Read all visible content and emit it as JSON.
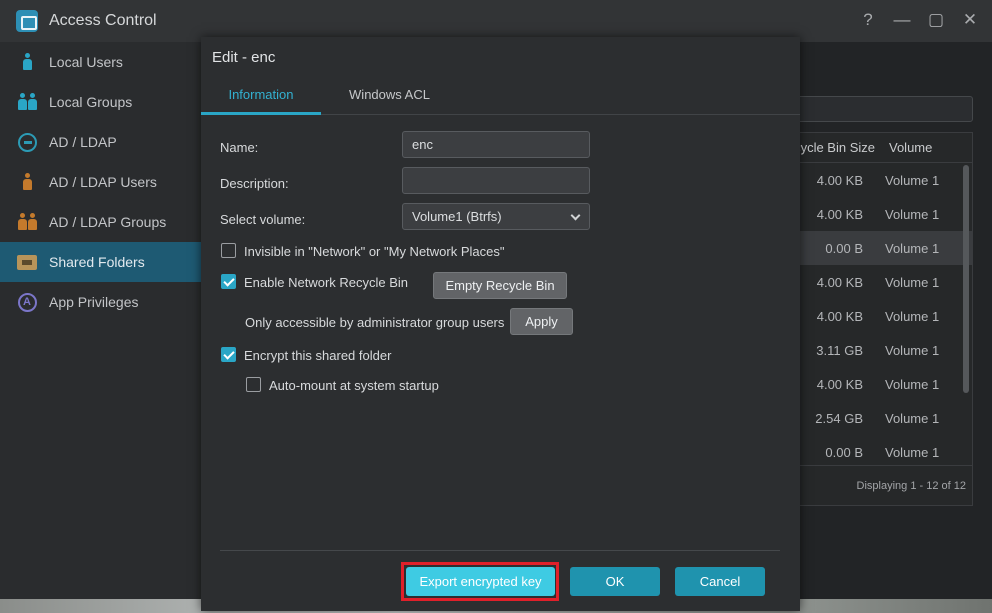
{
  "window": {
    "title": "Access Control",
    "controls": [
      "?",
      "—",
      "▢",
      "✕"
    ]
  },
  "sidebar": {
    "items": [
      {
        "label": "Local Users",
        "icon": "user-icon",
        "color": "#2aa6c6"
      },
      {
        "label": "Local Groups",
        "icon": "group-icon",
        "color": "#2aa6c6"
      },
      {
        "label": "AD / LDAP",
        "icon": "key-icon",
        "color": "#2aa6c6"
      },
      {
        "label": "AD / LDAP Users",
        "icon": "ad-user-icon",
        "color": "#c47a2c"
      },
      {
        "label": "AD / LDAP Groups",
        "icon": "ad-group-icon",
        "color": "#c47a2c"
      },
      {
        "label": "Shared Folders",
        "icon": "folder-icon",
        "color": "#b7945a",
        "active": true
      },
      {
        "label": "App Privileges",
        "icon": "privileges-icon",
        "color": "#7b76c9"
      }
    ]
  },
  "background_table": {
    "columns": [
      "ecycle Bin Size",
      "Volume"
    ],
    "rows": [
      {
        "size": "4.00 KB",
        "volume": "Volume 1"
      },
      {
        "size": "4.00 KB",
        "volume": "Volume 1"
      },
      {
        "size": "0.00 B",
        "volume": "Volume 1"
      },
      {
        "size": "4.00 KB",
        "volume": "Volume 1"
      },
      {
        "size": "4.00 KB",
        "volume": "Volume 1"
      },
      {
        "size": "3.11 GB",
        "volume": "Volume 1"
      },
      {
        "size": "4.00 KB",
        "volume": "Volume 1"
      },
      {
        "size": "2.54 GB",
        "volume": "Volume 1"
      },
      {
        "size": "0.00 B",
        "volume": "Volume 1"
      }
    ],
    "footer": "Displaying 1 - 12 of 12"
  },
  "dialog": {
    "title": "Edit - enc",
    "tabs": [
      "Information",
      "Windows ACL"
    ],
    "name_label": "Name:",
    "name_value": "enc",
    "description_label": "Description:",
    "description_value": "",
    "volume_label": "Select volume:",
    "volume_value": "Volume1 (Btrfs)",
    "invisible_label": "Invisible in \"Network\" or \"My Network Places\"",
    "recycle_label": "Enable Network Recycle Bin",
    "empty_recycle_button": "Empty Recycle Bin",
    "admin_only_label": "Only accessible by administrator group users",
    "apply_button": "Apply",
    "encrypt_label": "Encrypt this shared folder",
    "automount_label": "Auto-mount at system startup",
    "export_button": "Export encrypted key",
    "ok_button": "OK",
    "cancel_button": "Cancel"
  }
}
